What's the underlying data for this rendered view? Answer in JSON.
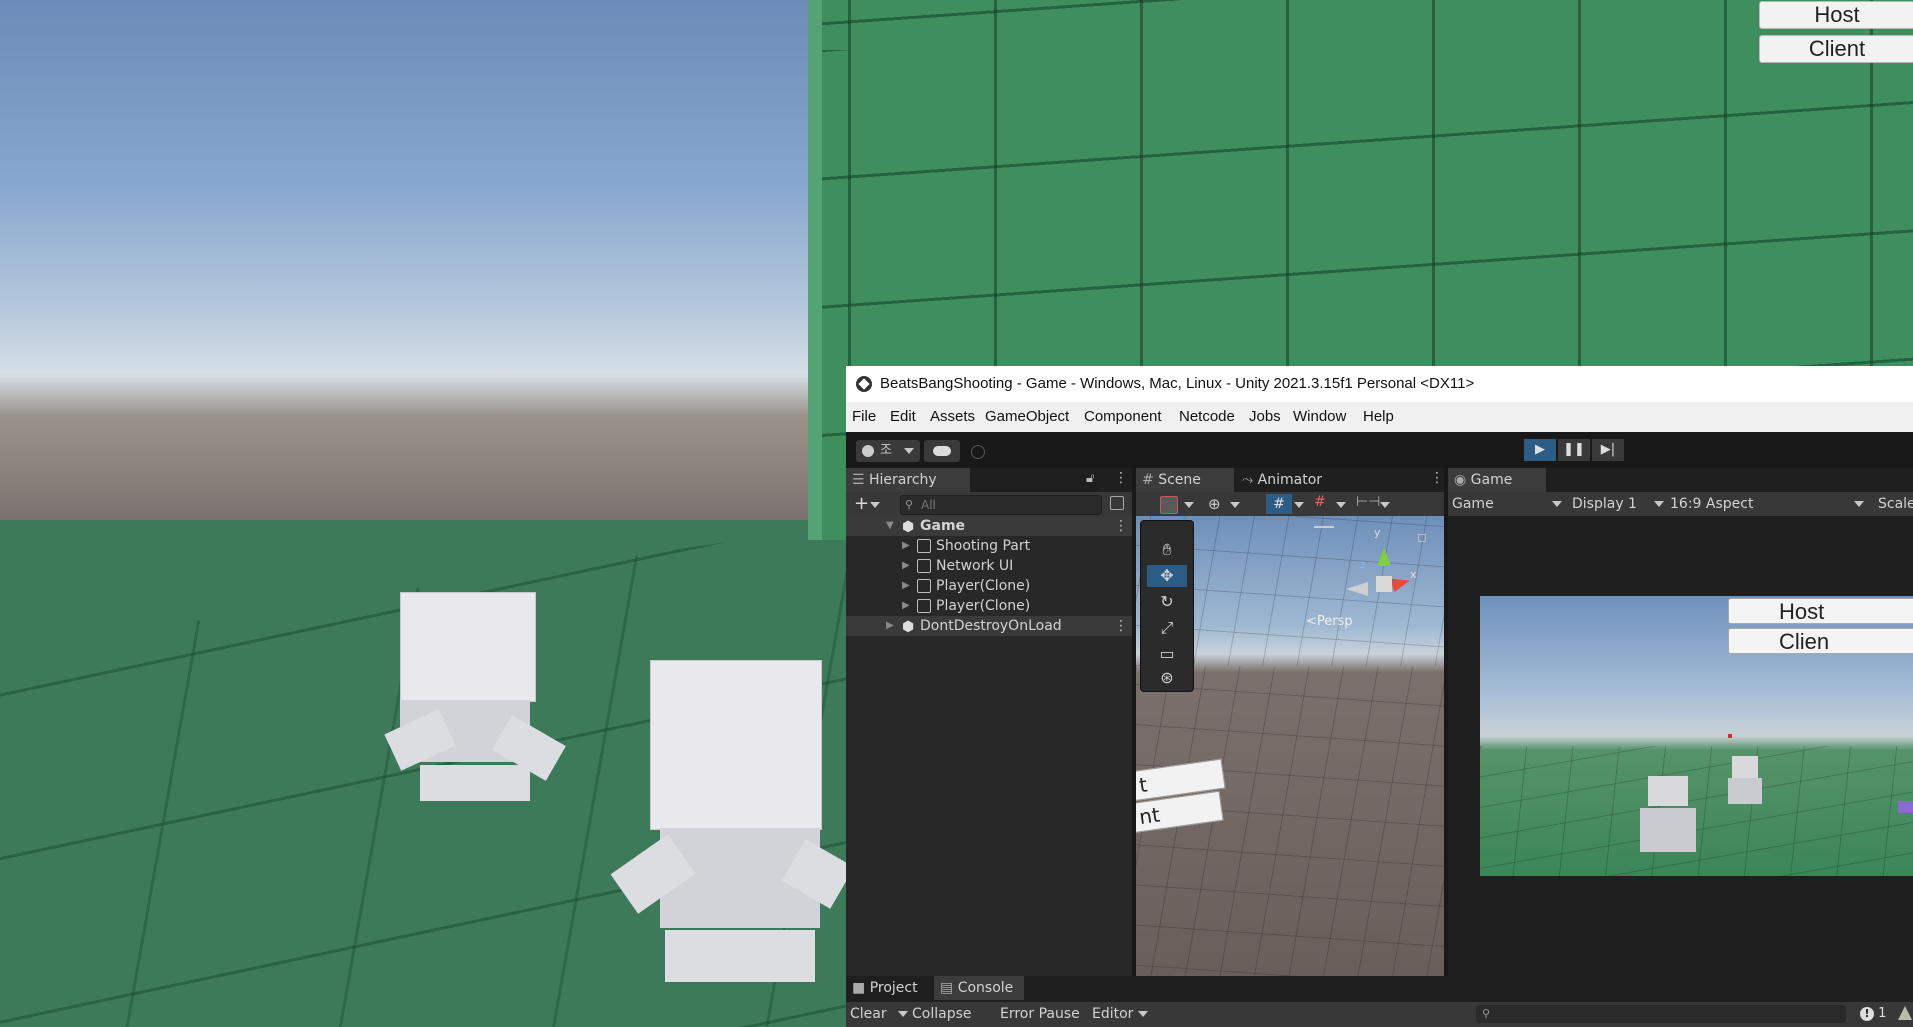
{
  "game_overlay": {
    "host_label": "Host",
    "client_label": "Client"
  },
  "window": {
    "title": "BeatsBangShooting - Game - Windows, Mac, Linux - Unity 2021.3.15f1 Personal <DX11>"
  },
  "menu": [
    "File",
    "Edit",
    "Assets",
    "GameObject",
    "Component",
    "Netcode",
    "Jobs",
    "Window",
    "Help"
  ],
  "toolbar": {
    "account_label": "조",
    "icons": [
      "account-icon",
      "cloud-icon",
      "collab-icon",
      "play-icon",
      "pause-icon",
      "step-icon"
    ]
  },
  "hierarchy": {
    "tab_label": "Hierarchy",
    "search_placeholder": "All",
    "scene_name": "Game",
    "items": [
      "Shooting Part",
      "Network UI",
      "Player(Clone)",
      "Player(Clone)"
    ],
    "ddol_name": "DontDestroyOnLoad"
  },
  "scene_view": {
    "tab_label": "Scene",
    "animator_tab_label": "Animator",
    "persp_label": "<Persp",
    "gizmo_y": "y",
    "gizmo_z": "z",
    "gizmo_x": "x",
    "partial_text_1": "t",
    "partial_text_2": "nt"
  },
  "game_view": {
    "tab_label": "Game",
    "mode_dropdown": "Game",
    "display_dropdown": "Display 1",
    "aspect_dropdown": "16:9 Aspect",
    "scale_label": "Scale",
    "host_label": "Host",
    "client_label": "Clien"
  },
  "console": {
    "project_tab": "Project",
    "console_tab": "Console",
    "clear_label": "Clear",
    "collapse_label": "Collapse",
    "error_pause_label": "Error Pause",
    "editor_label": "Editor",
    "count": "1"
  },
  "colors": {
    "play_active": "#2c5d87",
    "panel_bg": "#282828",
    "editor_bg": "#191919"
  }
}
